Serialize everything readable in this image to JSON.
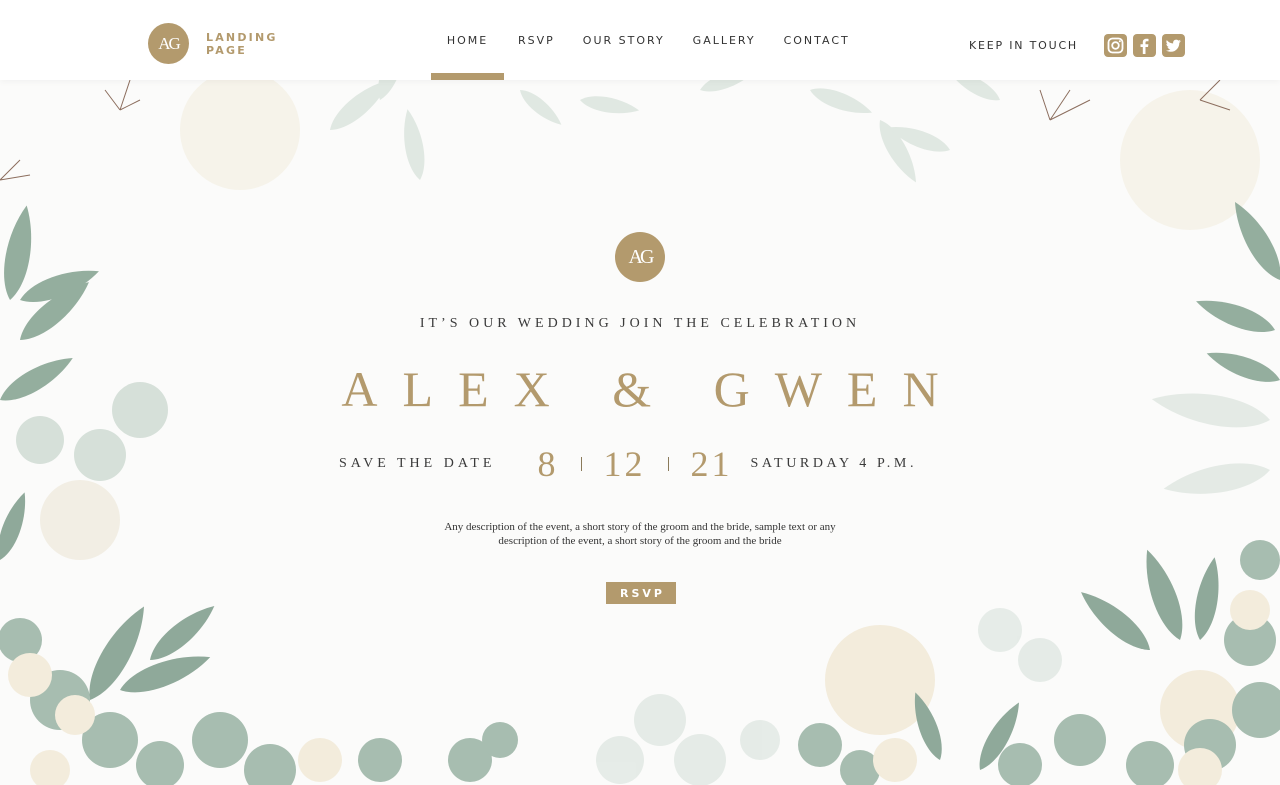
{
  "brand": {
    "badge": "AG",
    "line1": "LANDING",
    "line2": "PAGE"
  },
  "nav": [
    "HOME",
    "RSVP",
    "OUR STORY",
    "GALLERY",
    "CONTACT"
  ],
  "header": {
    "keep_in_touch": "KEEP IN TOUCH"
  },
  "social": [
    "instagram-icon",
    "facebook-icon",
    "twitter-icon"
  ],
  "hero": {
    "badge": "AG",
    "tagline": "IT’S OUR WEDDING JOIN THE CELEBRATION",
    "names": "ALEX & GWEN",
    "save_the_date": "SAVE THE DATE",
    "month": "8",
    "day": "12",
    "year": "21",
    "time": "SATURDAY 4 P.M.",
    "description_line1": "Any description of the event, a short story of the groom and the bride, sample text or any",
    "description_line2": "description of the event, a short story of the groom and the bride",
    "rsvp": "RSVP"
  },
  "colors": {
    "accent": "#b39a6d",
    "leaf": "#8fa99a",
    "flower": "#f3ecdc",
    "background": "#fbfbfa"
  }
}
